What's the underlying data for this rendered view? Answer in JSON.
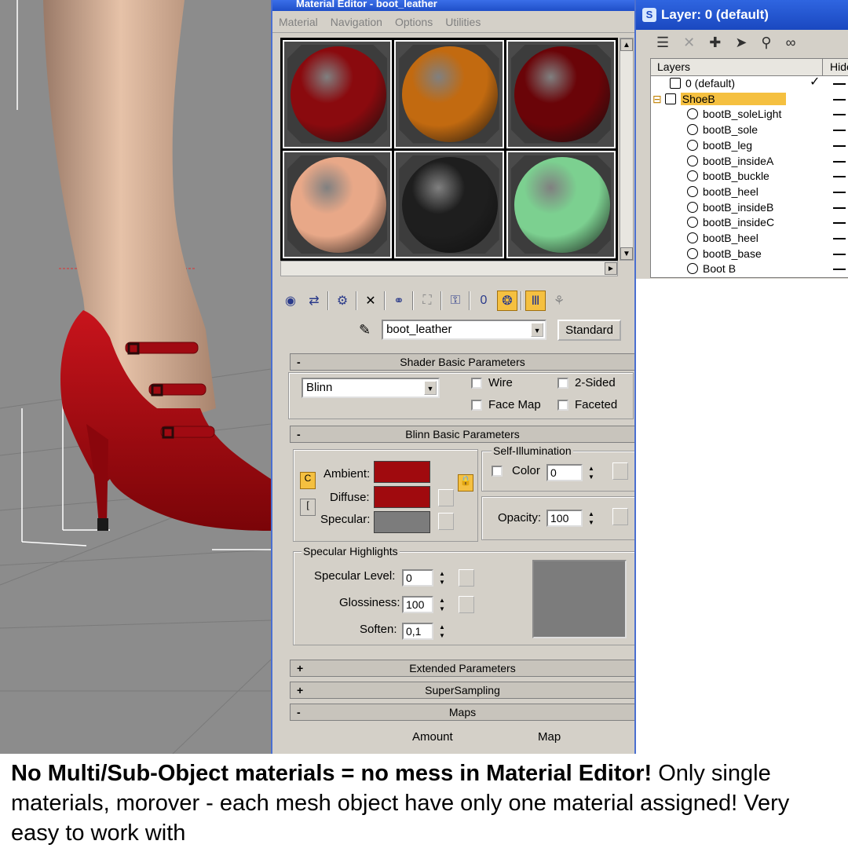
{
  "material_editor": {
    "title": "Material Editor - boot_leather",
    "menu": [
      "Material",
      "Navigation",
      "Options",
      "Utilities"
    ],
    "slot_colors": [
      "#8a0a0e",
      "#c26a10",
      "#6a0408",
      "#e8a888",
      "#1e1e1e",
      "#7cd090"
    ],
    "material_name": "boot_leather",
    "material_type": "Standard",
    "shader_rollout": "Shader Basic Parameters",
    "shader": "Blinn",
    "wire": "Wire",
    "two_sided": "2-Sided",
    "face_map": "Face Map",
    "faceted": "Faceted",
    "blinn_rollout": "Blinn Basic Parameters",
    "ambient": "Ambient:",
    "diffuse": "Diffuse:",
    "specular": "Specular:",
    "ambient_color": "#a00a0e",
    "diffuse_color": "#a00a0e",
    "specular_color": "#7c7c7c",
    "self_illum": "Self-Illumination",
    "color_label": "Color",
    "color_value": "0",
    "opacity_label": "Opacity:",
    "opacity_value": "100",
    "spec_highlights": "Specular Highlights",
    "spec_level_label": "Specular Level:",
    "spec_level": "0",
    "glossiness_label": "Glossiness:",
    "glossiness": "100",
    "soften_label": "Soften:",
    "soften": "0,1",
    "extended": "Extended Parameters",
    "supersampling": "SuperSampling",
    "maps": "Maps",
    "amount": "Amount",
    "map": "Map"
  },
  "layers": {
    "title": "Layer: 0 (default)",
    "col_layers": "Layers",
    "col_hide": "Hide",
    "rows": [
      "0 (default)",
      "ShoeB",
      "bootB_soleLight",
      "bootB_sole",
      "bootB_leg",
      "bootB_insideA",
      "bootB_buckle",
      "bootB_heel",
      "bootB_insideB",
      "bootB_insideC",
      "bootB_heel",
      "bootB_base",
      "Boot B"
    ]
  },
  "caption": {
    "bold": "No Multi/Sub-Object materials = no mess in Material Editor!",
    "rest": " Only single materials, morover - each mesh object have only one material assigned! Very easy to work with"
  }
}
